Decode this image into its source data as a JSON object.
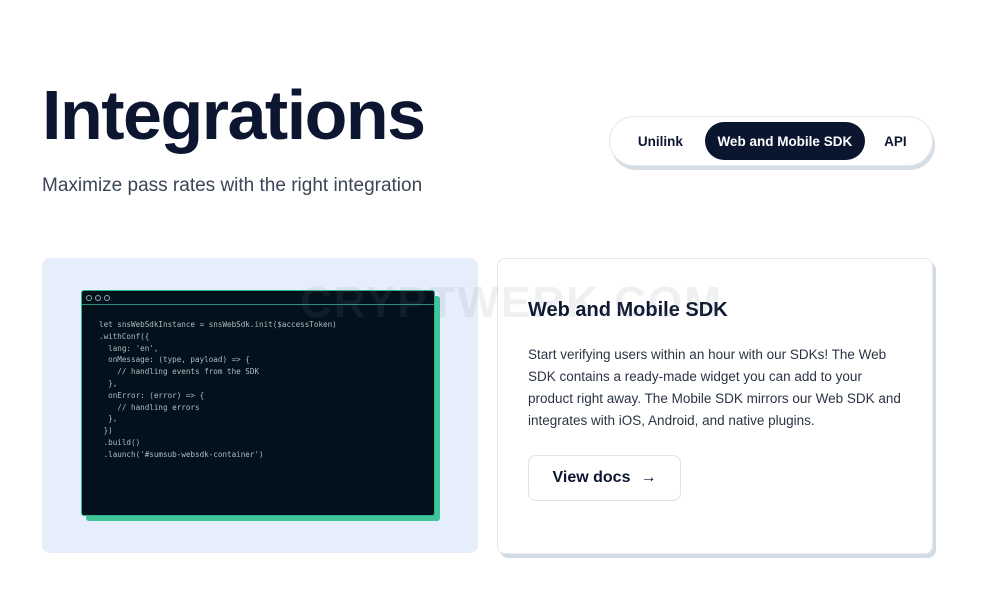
{
  "header": {
    "title": "Integrations",
    "subtitle": "Maximize pass rates with the right integration"
  },
  "tabs": [
    {
      "label": "Unilink",
      "active": false
    },
    {
      "label": "Web and Mobile SDK",
      "active": true
    },
    {
      "label": "API",
      "active": false
    }
  ],
  "code_snippet": {
    "lines": "let snsWebSdkInstance = snsWebSdk.init($accessToken)\n.withConf({\n  lang: 'en',\n  onMessage: (type, payload) => {\n    // handling events from the SDK\n  },\n  onError: (error) => {\n    // handling errors\n  },\n })\n .build()\n .launch('#sumsub-websdk-container')"
  },
  "card": {
    "title": "Web and Mobile SDK",
    "description": "Start verifying users within an hour with our SDKs! The Web SDK contains a ready-made widget you can add to your product right away. The Mobile SDK mirrors our Web SDK and integrates with iOS, Android, and native plugins.",
    "button_label": "View docs",
    "button_icon": "arrow-right-icon"
  },
  "watermark": "CRYPTWERK.COM",
  "colors": {
    "primary_dark": "#0a1530",
    "code_bg": "#02111c",
    "accent_green": "#3fc79a",
    "panel_bg": "#e7eefb"
  }
}
